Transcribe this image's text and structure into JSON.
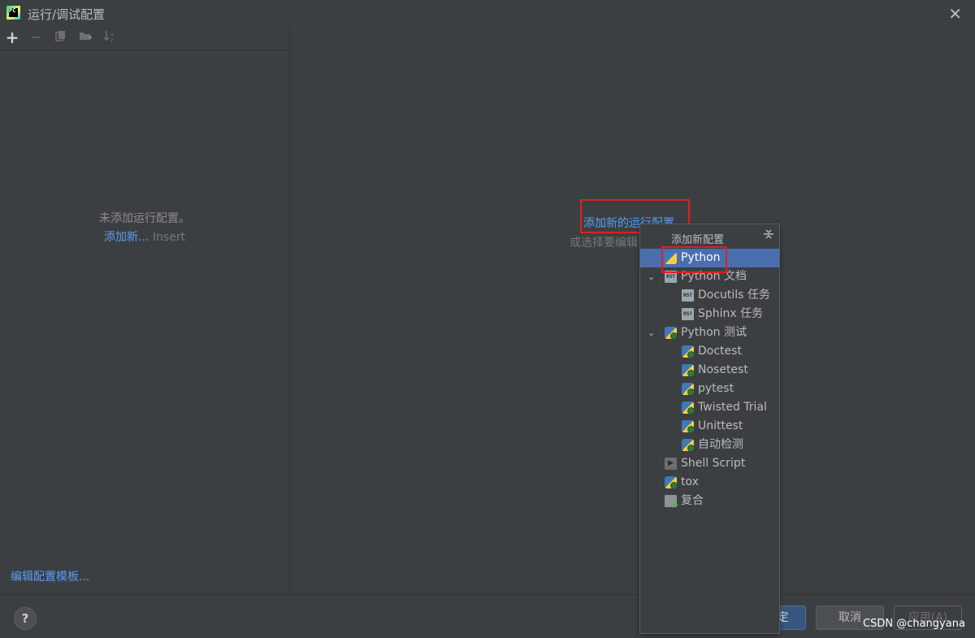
{
  "window": {
    "title": "运行/调试配置",
    "app_icon_text": "PC"
  },
  "left": {
    "empty_message": "未添加运行配置。",
    "add_new_link": "添加新...",
    "add_new_hint": "Insert",
    "edit_templates_link": "编辑配置模板..."
  },
  "right": {
    "add_new_config_link": "添加新的运行配置",
    "or_select_text": "或选择要编辑"
  },
  "popup": {
    "title": "添加新配置",
    "items": [
      {
        "label": "Python",
        "icon": "python-icon",
        "selected": true
      },
      {
        "label": "Python 文档",
        "icon": "rst-icon",
        "expanded": true
      },
      {
        "label": "Docutils 任务",
        "icon": "rst-icon"
      },
      {
        "label": "Sphinx 任务",
        "icon": "rst-icon"
      },
      {
        "label": "Python 测试",
        "icon": "python-test-icon",
        "expanded": true
      },
      {
        "label": "Doctest",
        "icon": "python-test-icon"
      },
      {
        "label": "Nosetest",
        "icon": "python-test-icon"
      },
      {
        "label": "pytest",
        "icon": "python-test-icon"
      },
      {
        "label": "Twisted Trial",
        "icon": "python-test-icon"
      },
      {
        "label": "Unittest",
        "icon": "python-test-icon"
      },
      {
        "label": "自动检测",
        "icon": "python-test-icon"
      },
      {
        "label": "Shell Script",
        "icon": "shell-script-icon"
      },
      {
        "label": "tox",
        "icon": "python-test-icon"
      },
      {
        "label": "复合",
        "icon": "compound-icon"
      }
    ]
  },
  "footer": {
    "help_label": "?",
    "ok_label": "定",
    "cancel_label": "取消",
    "apply_label": "应用(A)"
  },
  "watermark": "CSDN @changyana",
  "colors": {
    "background": "#3c3f41",
    "link": "#589df6",
    "selection": "#4b6eaf",
    "highlight_box": "#e0201f"
  }
}
